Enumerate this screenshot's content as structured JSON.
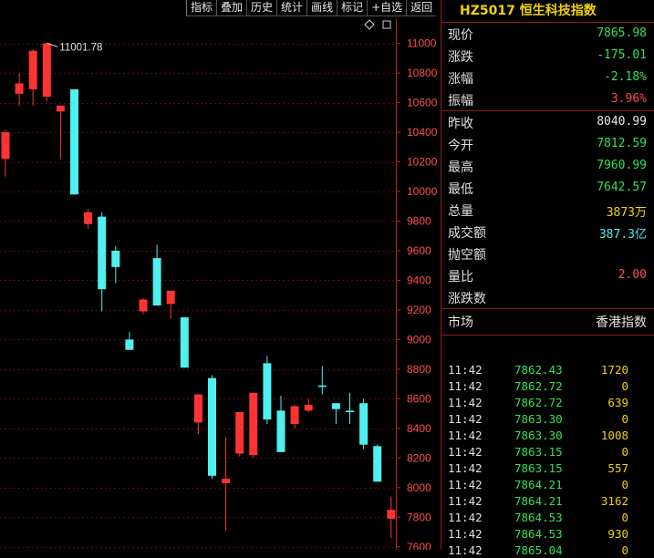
{
  "toolbar": [
    "指标",
    "叠加",
    "历史",
    "统计",
    "画线",
    "标记",
    "+自选",
    "返回"
  ],
  "chart": {
    "high_label": "11001.78",
    "colors": {
      "up": "#ff3333",
      "down": "#4ef0f0",
      "axis": "#c02020",
      "grid": "#5a0a0a",
      "tick_text": "#ff4d4d"
    }
  },
  "chart_data": {
    "type": "candlestick",
    "y_ticks": [
      11000,
      10800,
      10600,
      10400,
      10200,
      10000,
      9800,
      9600,
      9400,
      9200,
      9000,
      8800,
      8600,
      8400,
      8200,
      8000,
      7800,
      7600
    ],
    "ylim": [
      7580,
      11090
    ],
    "candles": [
      {
        "o": 10220,
        "h": 10420,
        "l": 10100,
        "c": 10400
      },
      {
        "o": 10660,
        "h": 10800,
        "l": 10580,
        "c": 10730
      },
      {
        "o": 10690,
        "h": 10960,
        "l": 10580,
        "c": 10950
      },
      {
        "o": 10640,
        "h": 11001.78,
        "l": 10610,
        "c": 11000
      },
      {
        "o": 10540,
        "h": 10580,
        "l": 10220,
        "c": 10580
      },
      {
        "o": 10690,
        "h": 10690,
        "l": 9980,
        "c": 9980
      },
      {
        "o": 9780,
        "h": 9880,
        "l": 9750,
        "c": 9860
      },
      {
        "o": 9830,
        "h": 9860,
        "l": 9190,
        "c": 9340
      },
      {
        "o": 9600,
        "h": 9630,
        "l": 9380,
        "c": 9490
      },
      {
        "o": 9000,
        "h": 9050,
        "l": 8940,
        "c": 8930
      },
      {
        "o": 9190,
        "h": 9280,
        "l": 9170,
        "c": 9270
      },
      {
        "o": 9550,
        "h": 9640,
        "l": 9240,
        "c": 9230
      },
      {
        "o": 9240,
        "h": 9330,
        "l": 9140,
        "c": 9330
      },
      {
        "o": 9150,
        "h": 9150,
        "l": 8810,
        "c": 8810
      },
      {
        "o": 8440,
        "h": 8630,
        "l": 8360,
        "c": 8630
      },
      {
        "o": 8740,
        "h": 8760,
        "l": 8060,
        "c": 8080
      },
      {
        "o": 8030,
        "h": 8340,
        "l": 7710,
        "c": 8060
      },
      {
        "o": 8230,
        "h": 8510,
        "l": 8210,
        "c": 8510
      },
      {
        "o": 8220,
        "h": 8640,
        "l": 8200,
        "c": 8640
      },
      {
        "o": 8840,
        "h": 8890,
        "l": 8430,
        "c": 8460
      },
      {
        "o": 8520,
        "h": 8620,
        "l": 8240,
        "c": 8240
      },
      {
        "o": 8430,
        "h": 8560,
        "l": 8400,
        "c": 8550
      },
      {
        "o": 8520,
        "h": 8600,
        "l": 8510,
        "c": 8560
      },
      {
        "o": 8690,
        "h": 8820,
        "l": 8630,
        "c": 8680
      },
      {
        "o": 8570,
        "h": 8560,
        "l": 8430,
        "c": 8530
      },
      {
        "o": 8520,
        "h": 8640,
        "l": 8430,
        "c": 8510
      },
      {
        "o": 8570,
        "h": 8600,
        "l": 8260,
        "c": 8290
      },
      {
        "o": 8280,
        "h": 8290,
        "l": 8060,
        "c": 8040
      },
      {
        "o": 7790,
        "h": 7940,
        "l": 7660,
        "c": 7850
      }
    ]
  },
  "panel": {
    "title": "HZ5017 恒生科技指数",
    "group1": [
      {
        "label": "现价",
        "value": "7865.98",
        "color": "#33e05a"
      },
      {
        "label": "涨跌",
        "value": "-175.01",
        "color": "#33e05a"
      },
      {
        "label": "涨幅",
        "value": "-2.18%",
        "color": "#33e05a"
      },
      {
        "label": "振幅",
        "value": "3.96%",
        "color": "#ff4d4d"
      }
    ],
    "group2": [
      {
        "label": "昨收",
        "value": "8040.99",
        "color": "#e8e8e8"
      },
      {
        "label": "今开",
        "value": "7812.59",
        "color": "#33e05a"
      },
      {
        "label": "最高",
        "value": "7960.99",
        "color": "#33e05a"
      },
      {
        "label": "最低",
        "value": "7642.57",
        "color": "#33e05a"
      },
      {
        "label": "总量",
        "value": "3873万",
        "color": "#f0d400"
      },
      {
        "label": "成交额",
        "value": "387.3亿",
        "color": "#4ef0f0"
      },
      {
        "label": "抛空额",
        "value": "",
        "color": "#e8e8e8"
      },
      {
        "label": "量比",
        "value": "2.00",
        "color": "#ff4d4d"
      },
      {
        "label": "涨跌数",
        "value": "",
        "color": "#e8e8e8"
      }
    ],
    "market_label": "市场",
    "market_value": "香港指数",
    "ticks": [
      {
        "t": "11:42",
        "p": "7862.43",
        "v": "1720"
      },
      {
        "t": "11:42",
        "p": "7862.72",
        "v": "0"
      },
      {
        "t": "11:42",
        "p": "7862.72",
        "v": "639"
      },
      {
        "t": "11:42",
        "p": "7863.30",
        "v": "0"
      },
      {
        "t": "11:42",
        "p": "7863.30",
        "v": "1008"
      },
      {
        "t": "11:42",
        "p": "7863.15",
        "v": "0"
      },
      {
        "t": "11:42",
        "p": "7863.15",
        "v": "557"
      },
      {
        "t": "11:42",
        "p": "7864.21",
        "v": "0"
      },
      {
        "t": "11:42",
        "p": "7864.21",
        "v": "3162"
      },
      {
        "t": "11:42",
        "p": "7864.53",
        "v": "0"
      },
      {
        "t": "11:42",
        "p": "7864.53",
        "v": "930"
      },
      {
        "t": "11:42",
        "p": "7865.04",
        "v": "0"
      }
    ]
  }
}
